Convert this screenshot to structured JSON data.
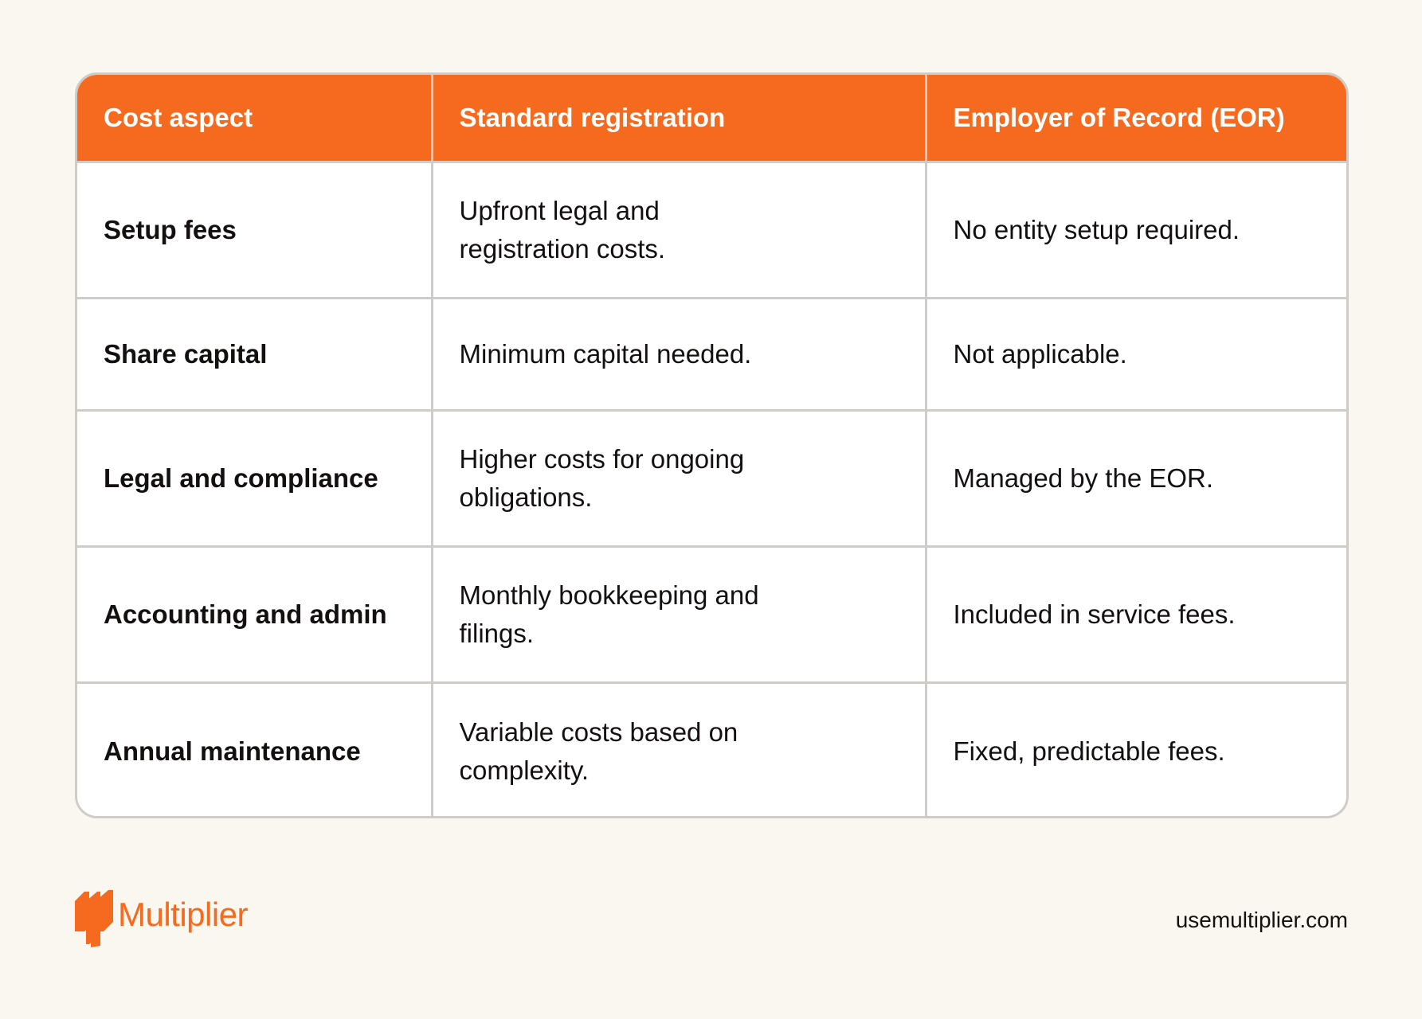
{
  "colors": {
    "background": "#FAF6F0",
    "header_bg": "#F56A1E",
    "header_text": "#FFFFFF",
    "border": "#CFCCC8",
    "text": "#141010",
    "brand": "#F56A1E"
  },
  "table": {
    "headers": [
      "Cost aspect",
      "Standard registration",
      "Employer of Record (EOR)"
    ],
    "rows": [
      {
        "aspect": "Setup fees",
        "standard": [
          "Upfront legal and",
          "registration costs."
        ],
        "eor": [
          "No entity setup required."
        ]
      },
      {
        "aspect": "Share capital",
        "standard": [
          "Minimum capital needed."
        ],
        "eor": [
          "Not applicable."
        ]
      },
      {
        "aspect": "Legal and compliance",
        "standard": [
          "Higher costs for ongoing",
          "obligations."
        ],
        "eor": [
          "Managed by the EOR."
        ]
      },
      {
        "aspect": "Accounting and admin",
        "standard": [
          "Monthly bookkeeping and",
          "filings."
        ],
        "eor": [
          "Included in service fees."
        ]
      },
      {
        "aspect": "Annual maintenance",
        "standard": [
          "Variable costs based on",
          "complexity."
        ],
        "eor": [
          "Fixed, predictable fees."
        ]
      }
    ]
  },
  "footer": {
    "logo_icon": "multiplier-logo-icon",
    "brand_name": "Multiplier",
    "url": "usemultiplier.com"
  }
}
